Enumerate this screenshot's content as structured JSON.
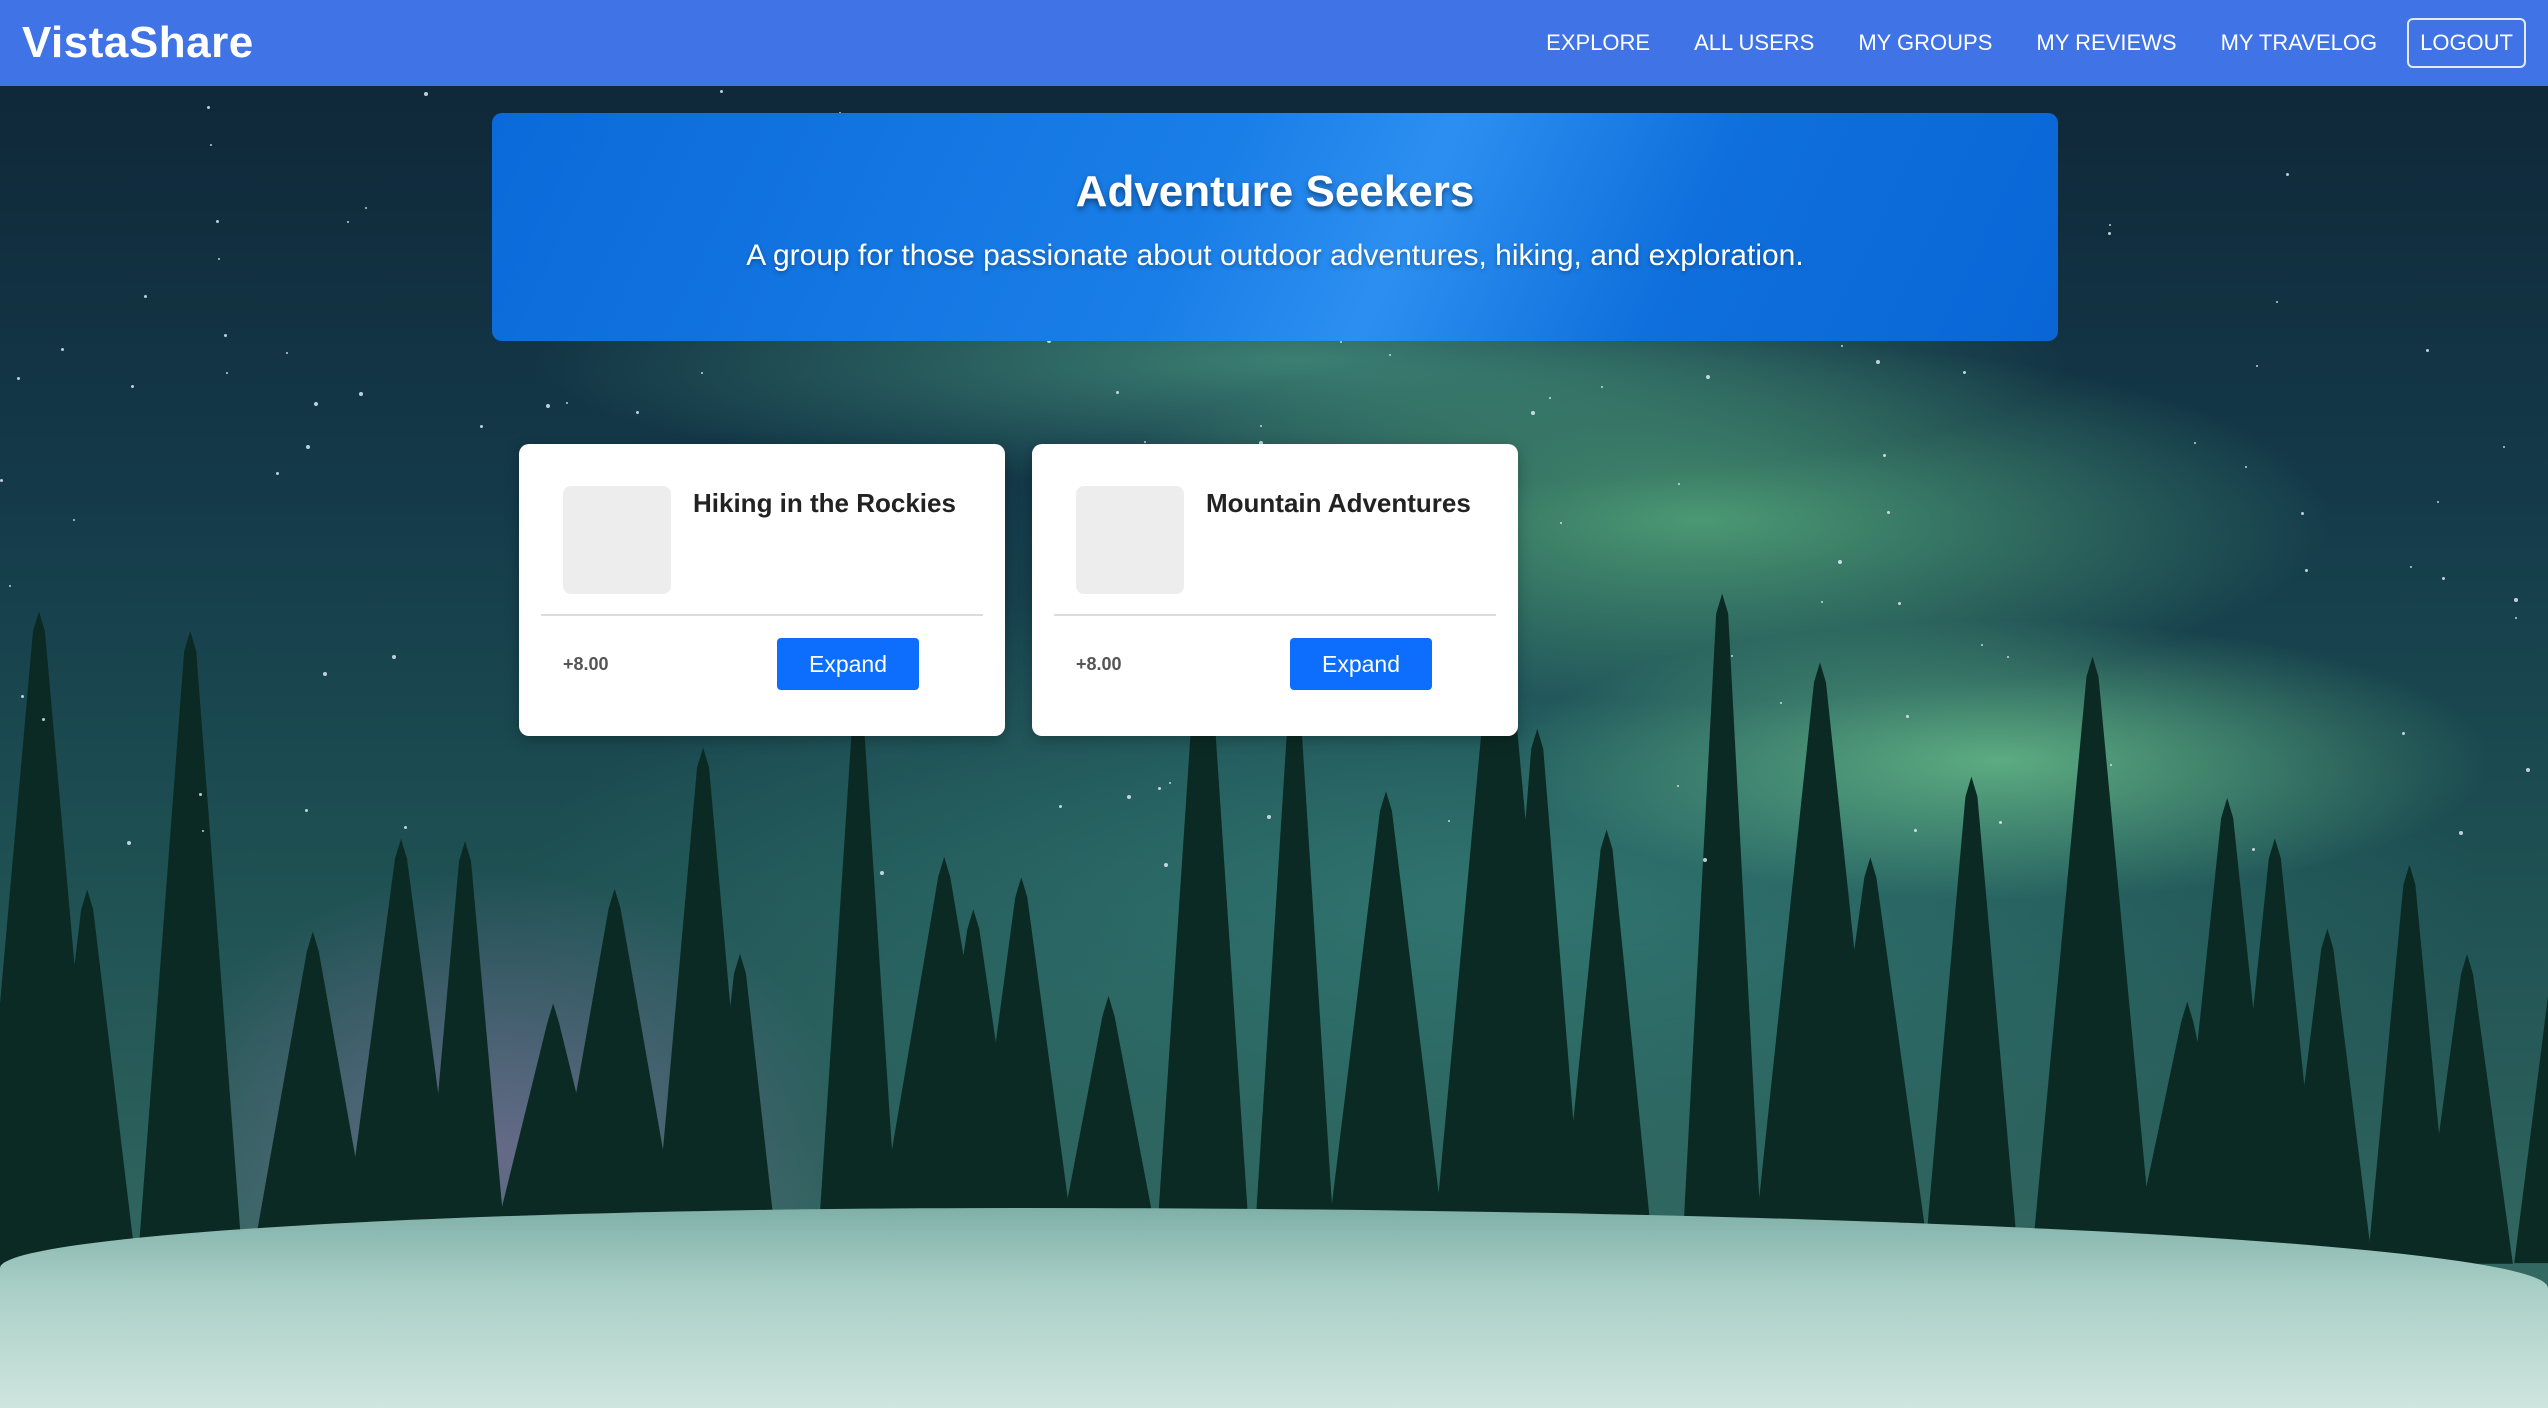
{
  "navbar": {
    "brand": "VistaShare",
    "links": [
      "EXPLORE",
      "ALL USERS",
      "MY GROUPS",
      "MY REVIEWS",
      "MY TRAVELOG"
    ],
    "logout": "LOGOUT",
    "background_color": "#3f73e6"
  },
  "group": {
    "title": "Adventure Seekers",
    "description": "A group for those passionate about outdoor adventures, hiking, and exploration."
  },
  "posts": [
    {
      "title": "Hiking in the Rockies",
      "rating": "+8.00",
      "button": "Expand"
    },
    {
      "title": "Mountain Adventures",
      "rating": "+8.00",
      "button": "Expand"
    }
  ],
  "colors": {
    "banner": "#0a6ad9",
    "button": "#0d6efd"
  }
}
